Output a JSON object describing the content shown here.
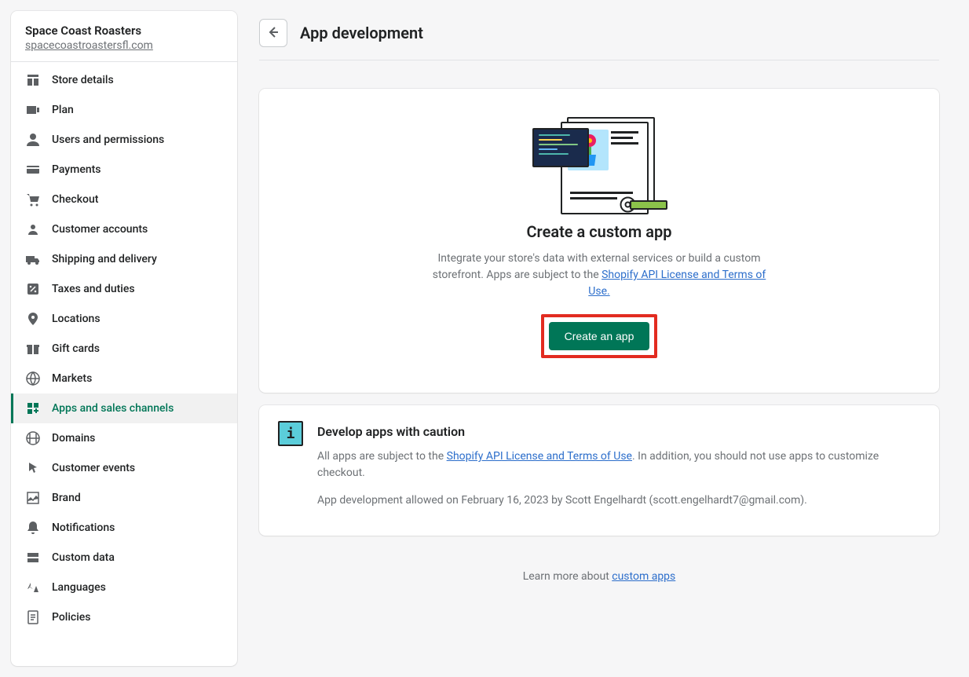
{
  "sidebar": {
    "store_name": "Space Coast Roasters",
    "store_domain": "spacecoastroastersfl.com",
    "items": [
      {
        "label": "Store details",
        "icon": "store-icon"
      },
      {
        "label": "Plan",
        "icon": "plan-icon"
      },
      {
        "label": "Users and permissions",
        "icon": "user-icon"
      },
      {
        "label": "Payments",
        "icon": "payments-icon"
      },
      {
        "label": "Checkout",
        "icon": "cart-icon"
      },
      {
        "label": "Customer accounts",
        "icon": "person-icon"
      },
      {
        "label": "Shipping and delivery",
        "icon": "truck-icon"
      },
      {
        "label": "Taxes and duties",
        "icon": "percent-icon"
      },
      {
        "label": "Locations",
        "icon": "pin-icon"
      },
      {
        "label": "Gift cards",
        "icon": "gift-icon"
      },
      {
        "label": "Markets",
        "icon": "globe-icon"
      },
      {
        "label": "Apps and sales channels",
        "icon": "grid-icon",
        "active": true
      },
      {
        "label": "Domains",
        "icon": "domain-icon"
      },
      {
        "label": "Customer events",
        "icon": "cursor-icon"
      },
      {
        "label": "Brand",
        "icon": "picture-icon"
      },
      {
        "label": "Notifications",
        "icon": "bell-icon"
      },
      {
        "label": "Custom data",
        "icon": "stack-icon"
      },
      {
        "label": "Languages",
        "icon": "language-icon"
      },
      {
        "label": "Policies",
        "icon": "document-icon"
      }
    ]
  },
  "header": {
    "title": "App development"
  },
  "create_card": {
    "heading": "Create a custom app",
    "description_prefix": "Integrate your store's data with external services or build a custom storefront. Apps are subject to the ",
    "link_text": "Shopify API License and Terms of Use.",
    "button_label": "Create an app"
  },
  "caution_card": {
    "heading": "Develop apps with caution",
    "body_prefix": "All apps are subject to the ",
    "link_text": "Shopify API License and Terms of Use",
    "body_suffix": ". In addition, you should not use apps to customize checkout.",
    "meta": "App development allowed on February 16, 2023 by Scott Engelhardt (scott.engelhardt7@gmail.com)."
  },
  "footer": {
    "prefix": "Learn more about ",
    "link_text": "custom apps"
  }
}
